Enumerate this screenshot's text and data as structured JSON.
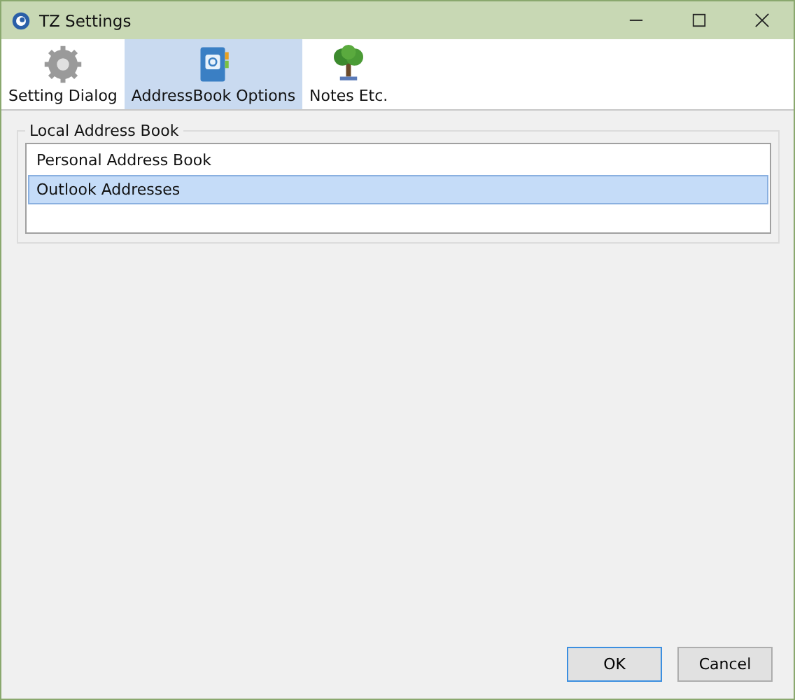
{
  "window": {
    "title": "TZ Settings"
  },
  "tabs": [
    {
      "label": "Setting Dialog",
      "selected": false
    },
    {
      "label": "AddressBook Options",
      "selected": true
    },
    {
      "label": "Notes Etc.",
      "selected": false
    }
  ],
  "group": {
    "title": "Local Address Book",
    "items": [
      {
        "label": "Personal Address Book",
        "selected": false
      },
      {
        "label": "Outlook Addresses",
        "selected": true
      }
    ]
  },
  "buttons": [
    {
      "label": "OK",
      "default": true
    },
    {
      "label": "Cancel",
      "default": false
    }
  ]
}
